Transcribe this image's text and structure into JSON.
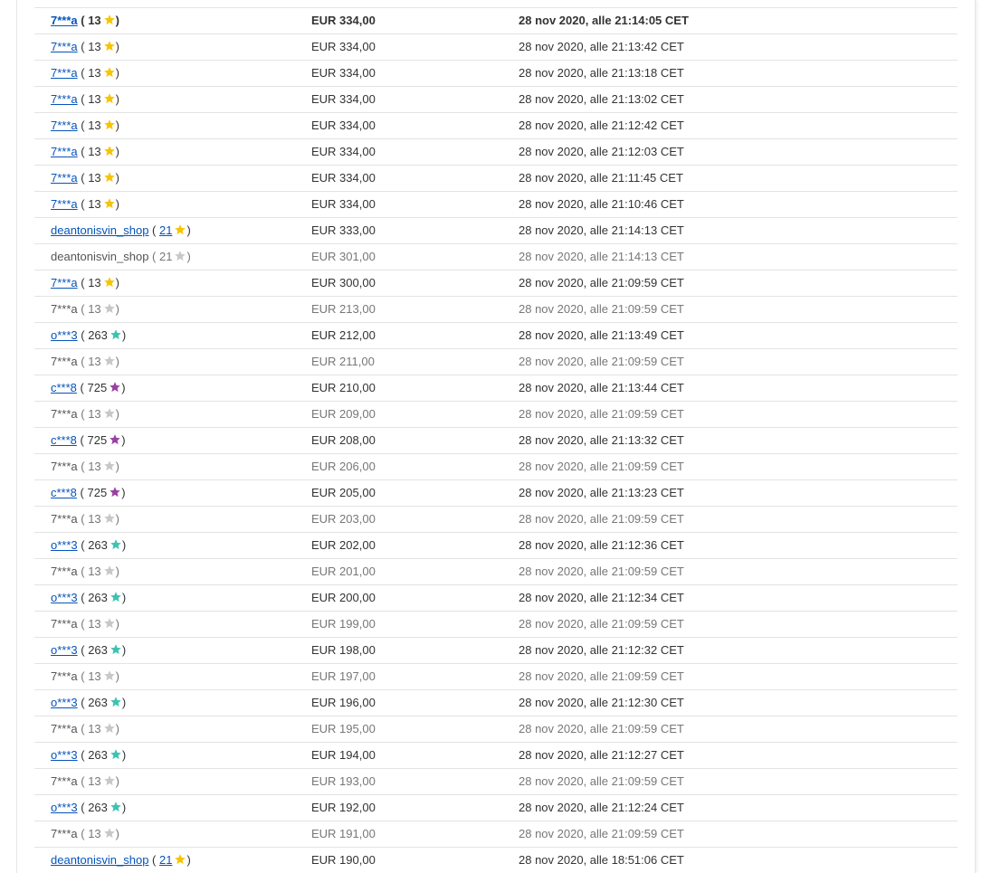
{
  "colors": {
    "link": "#0654ba",
    "star_yellow": "#f7c400",
    "star_gray": "#c8c8c8",
    "star_turquoise": "#3cc3b1",
    "star_purple": "#9b3fa4"
  },
  "bids": [
    {
      "bidder": "7***a",
      "feedback": "13",
      "star": "yellow",
      "amount": "EUR 334,00",
      "time": "28 nov 2020, alle 21:14:05 CET",
      "linked": true,
      "fb_linked": false,
      "retracted": false,
      "top": true
    },
    {
      "bidder": "7***a",
      "feedback": "13",
      "star": "yellow",
      "amount": "EUR 334,00",
      "time": "28 nov 2020, alle 21:13:42 CET",
      "linked": true,
      "fb_linked": false,
      "retracted": false,
      "top": false
    },
    {
      "bidder": "7***a",
      "feedback": "13",
      "star": "yellow",
      "amount": "EUR 334,00",
      "time": "28 nov 2020, alle 21:13:18 CET",
      "linked": true,
      "fb_linked": false,
      "retracted": false,
      "top": false
    },
    {
      "bidder": "7***a",
      "feedback": "13",
      "star": "yellow",
      "amount": "EUR 334,00",
      "time": "28 nov 2020, alle 21:13:02 CET",
      "linked": true,
      "fb_linked": false,
      "retracted": false,
      "top": false
    },
    {
      "bidder": "7***a",
      "feedback": "13",
      "star": "yellow",
      "amount": "EUR 334,00",
      "time": "28 nov 2020, alle 21:12:42 CET",
      "linked": true,
      "fb_linked": false,
      "retracted": false,
      "top": false
    },
    {
      "bidder": "7***a",
      "feedback": "13",
      "star": "yellow",
      "amount": "EUR 334,00",
      "time": "28 nov 2020, alle 21:12:03 CET",
      "linked": true,
      "fb_linked": false,
      "retracted": false,
      "top": false
    },
    {
      "bidder": "7***a",
      "feedback": "13",
      "star": "yellow",
      "amount": "EUR 334,00",
      "time": "28 nov 2020, alle 21:11:45 CET",
      "linked": true,
      "fb_linked": false,
      "retracted": false,
      "top": false
    },
    {
      "bidder": "7***a",
      "feedback": "13",
      "star": "yellow",
      "amount": "EUR 334,00",
      "time": "28 nov 2020, alle 21:10:46 CET",
      "linked": true,
      "fb_linked": false,
      "retracted": false,
      "top": false
    },
    {
      "bidder": "deantonisvin_shop",
      "feedback": "21",
      "star": "yellow",
      "amount": "EUR 333,00",
      "time": "28 nov 2020, alle 21:14:13 CET",
      "linked": true,
      "fb_linked": true,
      "retracted": false,
      "top": false
    },
    {
      "bidder": "deantonisvin_shop",
      "feedback": "21",
      "star": "gray",
      "amount": "EUR 301,00",
      "time": "28 nov 2020, alle 21:14:13 CET",
      "linked": false,
      "fb_linked": false,
      "retracted": true,
      "top": false
    },
    {
      "bidder": "7***a",
      "feedback": "13",
      "star": "yellow",
      "amount": "EUR 300,00",
      "time": "28 nov 2020, alle 21:09:59 CET",
      "linked": true,
      "fb_linked": false,
      "retracted": false,
      "top": false
    },
    {
      "bidder": "7***a",
      "feedback": "13",
      "star": "gray",
      "amount": "EUR 213,00",
      "time": "28 nov 2020, alle 21:09:59 CET",
      "linked": false,
      "fb_linked": false,
      "retracted": true,
      "top": false
    },
    {
      "bidder": "o***3",
      "feedback": "263",
      "star": "turquoise",
      "amount": "EUR 212,00",
      "time": "28 nov 2020, alle 21:13:49 CET",
      "linked": true,
      "fb_linked": false,
      "retracted": false,
      "top": false
    },
    {
      "bidder": "7***a",
      "feedback": "13",
      "star": "gray",
      "amount": "EUR 211,00",
      "time": "28 nov 2020, alle 21:09:59 CET",
      "linked": false,
      "fb_linked": false,
      "retracted": true,
      "top": false
    },
    {
      "bidder": "c***8",
      "feedback": "725",
      "star": "purple",
      "amount": "EUR 210,00",
      "time": "28 nov 2020, alle 21:13:44 CET",
      "linked": true,
      "fb_linked": false,
      "retracted": false,
      "top": false
    },
    {
      "bidder": "7***a",
      "feedback": "13",
      "star": "gray",
      "amount": "EUR 209,00",
      "time": "28 nov 2020, alle 21:09:59 CET",
      "linked": false,
      "fb_linked": false,
      "retracted": true,
      "top": false
    },
    {
      "bidder": "c***8",
      "feedback": "725",
      "star": "purple",
      "amount": "EUR 208,00",
      "time": "28 nov 2020, alle 21:13:32 CET",
      "linked": true,
      "fb_linked": false,
      "retracted": false,
      "top": false
    },
    {
      "bidder": "7***a",
      "feedback": "13",
      "star": "gray",
      "amount": "EUR 206,00",
      "time": "28 nov 2020, alle 21:09:59 CET",
      "linked": false,
      "fb_linked": false,
      "retracted": true,
      "top": false
    },
    {
      "bidder": "c***8",
      "feedback": "725",
      "star": "purple",
      "amount": "EUR 205,00",
      "time": "28 nov 2020, alle 21:13:23 CET",
      "linked": true,
      "fb_linked": false,
      "retracted": false,
      "top": false
    },
    {
      "bidder": "7***a",
      "feedback": "13",
      "star": "gray",
      "amount": "EUR 203,00",
      "time": "28 nov 2020, alle 21:09:59 CET",
      "linked": false,
      "fb_linked": false,
      "retracted": true,
      "top": false
    },
    {
      "bidder": "o***3",
      "feedback": "263",
      "star": "turquoise",
      "amount": "EUR 202,00",
      "time": "28 nov 2020, alle 21:12:36 CET",
      "linked": true,
      "fb_linked": false,
      "retracted": false,
      "top": false
    },
    {
      "bidder": "7***a",
      "feedback": "13",
      "star": "gray",
      "amount": "EUR 201,00",
      "time": "28 nov 2020, alle 21:09:59 CET",
      "linked": false,
      "fb_linked": false,
      "retracted": true,
      "top": false
    },
    {
      "bidder": "o***3",
      "feedback": "263",
      "star": "turquoise",
      "amount": "EUR 200,00",
      "time": "28 nov 2020, alle 21:12:34 CET",
      "linked": true,
      "fb_linked": false,
      "retracted": false,
      "top": false
    },
    {
      "bidder": "7***a",
      "feedback": "13",
      "star": "gray",
      "amount": "EUR 199,00",
      "time": "28 nov 2020, alle 21:09:59 CET",
      "linked": false,
      "fb_linked": false,
      "retracted": true,
      "top": false
    },
    {
      "bidder": "o***3",
      "feedback": "263",
      "star": "turquoise",
      "amount": "EUR 198,00",
      "time": "28 nov 2020, alle 21:12:32 CET",
      "linked": true,
      "fb_linked": false,
      "retracted": false,
      "top": false
    },
    {
      "bidder": "7***a",
      "feedback": "13",
      "star": "gray",
      "amount": "EUR 197,00",
      "time": "28 nov 2020, alle 21:09:59 CET",
      "linked": false,
      "fb_linked": false,
      "retracted": true,
      "top": false
    },
    {
      "bidder": "o***3",
      "feedback": "263",
      "star": "turquoise",
      "amount": "EUR 196,00",
      "time": "28 nov 2020, alle 21:12:30 CET",
      "linked": true,
      "fb_linked": false,
      "retracted": false,
      "top": false
    },
    {
      "bidder": "7***a",
      "feedback": "13",
      "star": "gray",
      "amount": "EUR 195,00",
      "time": "28 nov 2020, alle 21:09:59 CET",
      "linked": false,
      "fb_linked": false,
      "retracted": true,
      "top": false
    },
    {
      "bidder": "o***3",
      "feedback": "263",
      "star": "turquoise",
      "amount": "EUR 194,00",
      "time": "28 nov 2020, alle 21:12:27 CET",
      "linked": true,
      "fb_linked": false,
      "retracted": false,
      "top": false
    },
    {
      "bidder": "7***a",
      "feedback": "13",
      "star": "gray",
      "amount": "EUR 193,00",
      "time": "28 nov 2020, alle 21:09:59 CET",
      "linked": false,
      "fb_linked": false,
      "retracted": true,
      "top": false
    },
    {
      "bidder": "o***3",
      "feedback": "263",
      "star": "turquoise",
      "amount": "EUR 192,00",
      "time": "28 nov 2020, alle 21:12:24 CET",
      "linked": true,
      "fb_linked": false,
      "retracted": false,
      "top": false
    },
    {
      "bidder": "7***a",
      "feedback": "13",
      "star": "gray",
      "amount": "EUR 191,00",
      "time": "28 nov 2020, alle 21:09:59 CET",
      "linked": false,
      "fb_linked": false,
      "retracted": true,
      "top": false
    },
    {
      "bidder": "deantonisvin_shop",
      "feedback": "21",
      "star": "yellow",
      "amount": "EUR 190,00",
      "time": "28 nov 2020, alle 18:51:06 CET",
      "linked": true,
      "fb_linked": true,
      "retracted": false,
      "top": false
    }
  ]
}
